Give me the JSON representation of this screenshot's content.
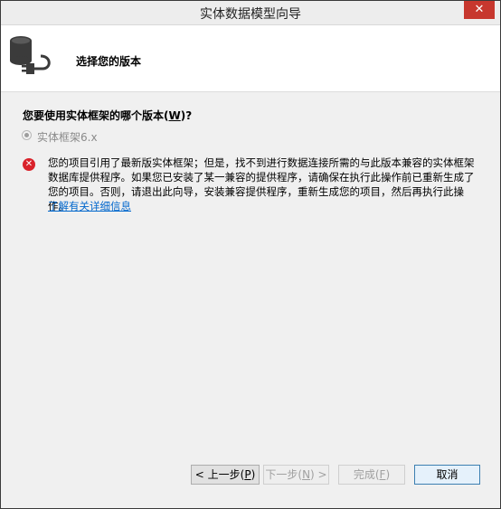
{
  "window": {
    "title": "实体数据模型向导",
    "close_glyph": "✕"
  },
  "header": {
    "title": "选择您的版本",
    "icon": "database-plug-icon"
  },
  "question": {
    "text": "您要使用实体框架的哪个版本(",
    "hotkey": "W",
    "suffix": ")?"
  },
  "options": [
    {
      "label": "实体框架6.x",
      "selected": true,
      "enabled": false
    }
  ],
  "error": {
    "icon": "error-icon",
    "glyph": "✕",
    "message": "您的项目引用了最新版实体框架；但是，找不到进行数据连接所需的与此版本兼容的实体框架数据库提供程序。如果您已安装了某一兼容的提供程序，请确保在执行此操作前已重新生成了您的项目。否则，请退出此向导，安装兼容提供程序，重新生成您的项目，然后再执行此操作。",
    "link": "了解有关详细信息"
  },
  "buttons": {
    "back": {
      "prefix": "< 上一步(",
      "hotkey": "P",
      "suffix": ")"
    },
    "next": {
      "prefix": "下一步(",
      "hotkey": "N",
      "suffix": ") >"
    },
    "finish": {
      "prefix": "完成(",
      "hotkey": "F",
      "suffix": ")"
    },
    "cancel": {
      "label": "取消"
    }
  },
  "colors": {
    "accent": "#3c7fb1",
    "error": "#d9222a",
    "link": "#0066cc",
    "close": "#c7372e"
  }
}
